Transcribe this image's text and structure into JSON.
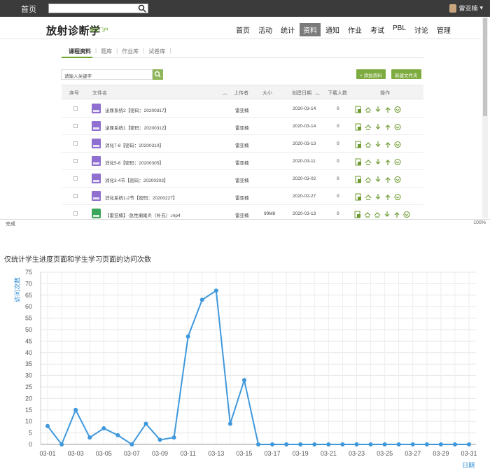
{
  "topbar": {
    "home": "首页",
    "user": "雷亚楠",
    "user_caret": "▾"
  },
  "header": {
    "brand": "放射诊断学",
    "brand_sub": "课程门户",
    "nav": [
      "首页",
      "活动",
      "统计",
      "资料",
      "通知",
      "作业",
      "考试",
      "PBL",
      "讨论",
      "管理"
    ],
    "nav_active": "资料"
  },
  "subtabs": [
    "课程资料",
    "题库",
    "作业库",
    "试卷库"
  ],
  "search": {
    "placeholder": "请输入关键字"
  },
  "buttons": {
    "add_material": "+ 添加资料",
    "new_folder": "新建文件夹"
  },
  "table": {
    "headers": [
      "序号",
      "文件名",
      "上传者",
      "大小",
      "创建日期",
      "下载人数",
      "操作"
    ],
    "rows": [
      {
        "name": "泌尿系统2【密码：20200317】",
        "uploader": "雷亚楠",
        "size": "",
        "date": "2020-03-14",
        "downloads": "0",
        "type": "folder"
      },
      {
        "name": "泌尿系统1【密码：20200312】",
        "uploader": "雷亚楠",
        "size": "",
        "date": "2020-03-14",
        "downloads": "0",
        "type": "folder"
      },
      {
        "name": "消化7-8【密码：20200310】",
        "uploader": "雷亚楠",
        "size": "",
        "date": "2020-03-13",
        "downloads": "0",
        "type": "folder"
      },
      {
        "name": "消化5-6【密码：20200305】",
        "uploader": "雷亚楠",
        "size": "",
        "date": "2020-03-11",
        "downloads": "0",
        "type": "folder"
      },
      {
        "name": "消化3-4节【密码：20200303】",
        "uploader": "雷亚楠",
        "size": "",
        "date": "2020-03-02",
        "downloads": "0",
        "type": "folder"
      },
      {
        "name": "消化系统1-2节【密码：20200227】",
        "uploader": "雷亚楠",
        "size": "",
        "date": "2020-02-27",
        "downloads": "0",
        "type": "folder"
      },
      {
        "name": "【雷亚楠】-急性阑尾炎（补充）.mp4",
        "uploader": "雷亚楠",
        "size": "99M8",
        "date": "2020-03-13",
        "downloads": "0",
        "type": "video"
      }
    ]
  },
  "statusbar": {
    "done": "完成",
    "zoom": "100%"
  },
  "chart_title": "仅统计学生进度页面和学生学习页面的访问次数",
  "chart_data": {
    "type": "line",
    "title": "仅统计学生进度页面和学生学习页面的访问次数",
    "xlabel": "日期",
    "ylabel": "访问次数",
    "ylim": [
      0,
      75
    ],
    "yticks": [
      0,
      5,
      10,
      15,
      20,
      25,
      30,
      35,
      40,
      45,
      50,
      55,
      60,
      65,
      70,
      75
    ],
    "x": [
      "03-01",
      "03-02",
      "03-03",
      "03-04",
      "03-05",
      "03-06",
      "03-07",
      "03-08",
      "03-09",
      "03-10",
      "03-11",
      "03-12",
      "03-13",
      "03-14",
      "03-15",
      "03-16",
      "03-17",
      "03-18",
      "03-19",
      "03-20",
      "03-21",
      "03-22",
      "03-23",
      "03-24",
      "03-25",
      "03-26",
      "03-27",
      "03-28",
      "03-29",
      "03-30",
      "03-31"
    ],
    "xtick_labels": [
      "03-01",
      "03-03",
      "03-05",
      "03-07",
      "03-09",
      "03-11",
      "03-13",
      "03-15",
      "03-17",
      "03-19",
      "03-21",
      "03-23",
      "03-25",
      "03-27",
      "03-29",
      "03-31"
    ],
    "series": [
      {
        "values": [
          8,
          0,
          15,
          3,
          7,
          4,
          0,
          9,
          2,
          3,
          47,
          63,
          67,
          9,
          28,
          0,
          0,
          0,
          0,
          0,
          0,
          0,
          0,
          0,
          0,
          0,
          0,
          0,
          0,
          0,
          0
        ]
      }
    ],
    "color": "#3f98dc",
    "grid": true
  }
}
